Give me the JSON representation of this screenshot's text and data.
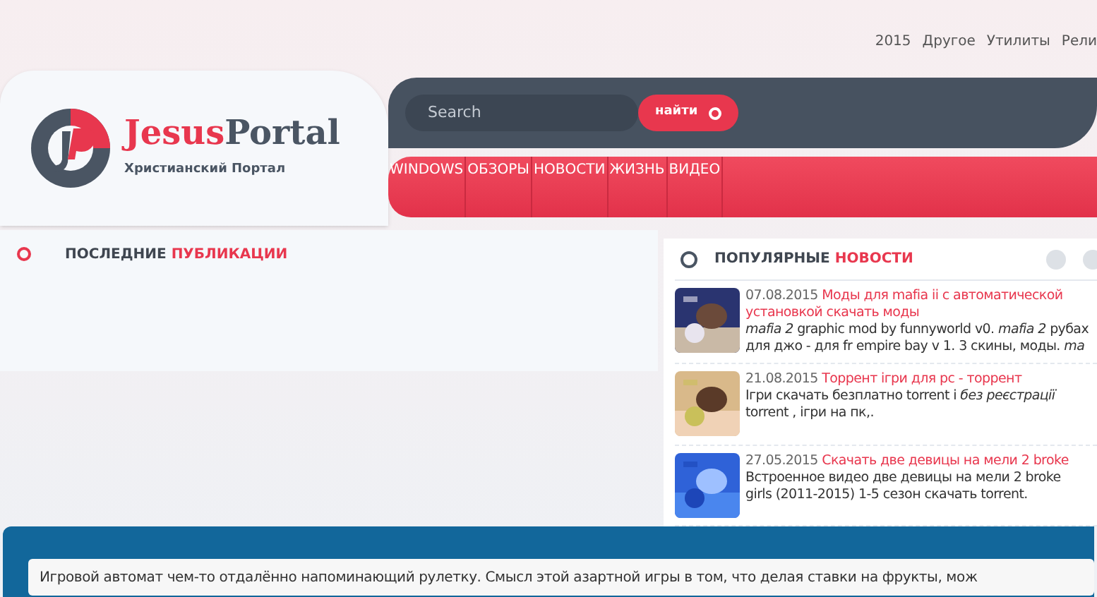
{
  "top_links": [
    "2015",
    "Другое",
    "Утилиты",
    "Рели"
  ],
  "logo": {
    "name_accent": "Jesus",
    "name_rest": "Portal",
    "tagline": "Христианский Портал"
  },
  "search": {
    "placeholder": "Search",
    "button": "найти"
  },
  "menu": [
    {
      "label": "WINDOWS"
    },
    {
      "label": "ОБЗОРЫ"
    },
    {
      "label": "НОВОСТИ"
    },
    {
      "label": "ЖИЗНЬ"
    },
    {
      "label": "ВИДЕО"
    }
  ],
  "latest": {
    "title": "ПОСЛЕДНИЕ",
    "title_accent": "ПУБЛИКАЦИИ"
  },
  "popular": {
    "title": "ПОПУЛЯРНЫЕ",
    "title_accent": "НОВОСТИ",
    "items": [
      {
        "date": "07.08.2015",
        "headline": "Моды для mafia ii с автоматической установкой скачать моды",
        "snippet": [
          "*mafia 2* graphic mod by funnyworld v0. *mafia 2* рубах",
          "для джо - для fr empire bay v 1. 3 скины, моды. *ma*"
        ]
      },
      {
        "date": "21.08.2015",
        "headline": "Торрент ігри для pc - торрент",
        "snippet": [
          "Ігри скачать безплатно torrent і *без реєстрації*",
          "torrent , ігри на пк,."
        ]
      },
      {
        "date": "27.05.2015",
        "headline": "Скачать две девицы на мели 2 broke",
        "snippet": [
          "Встроенное видео  две девицы на мели 2 broke",
          "girls (2011-2015) 1-5 сезон скачать torrent."
        ]
      }
    ]
  },
  "ticker": "Игровой автомат чем-то отдалённо напоминающий рулетку. Смысл этой азартной игры в том, что делая ставки на фрукты, мож"
}
